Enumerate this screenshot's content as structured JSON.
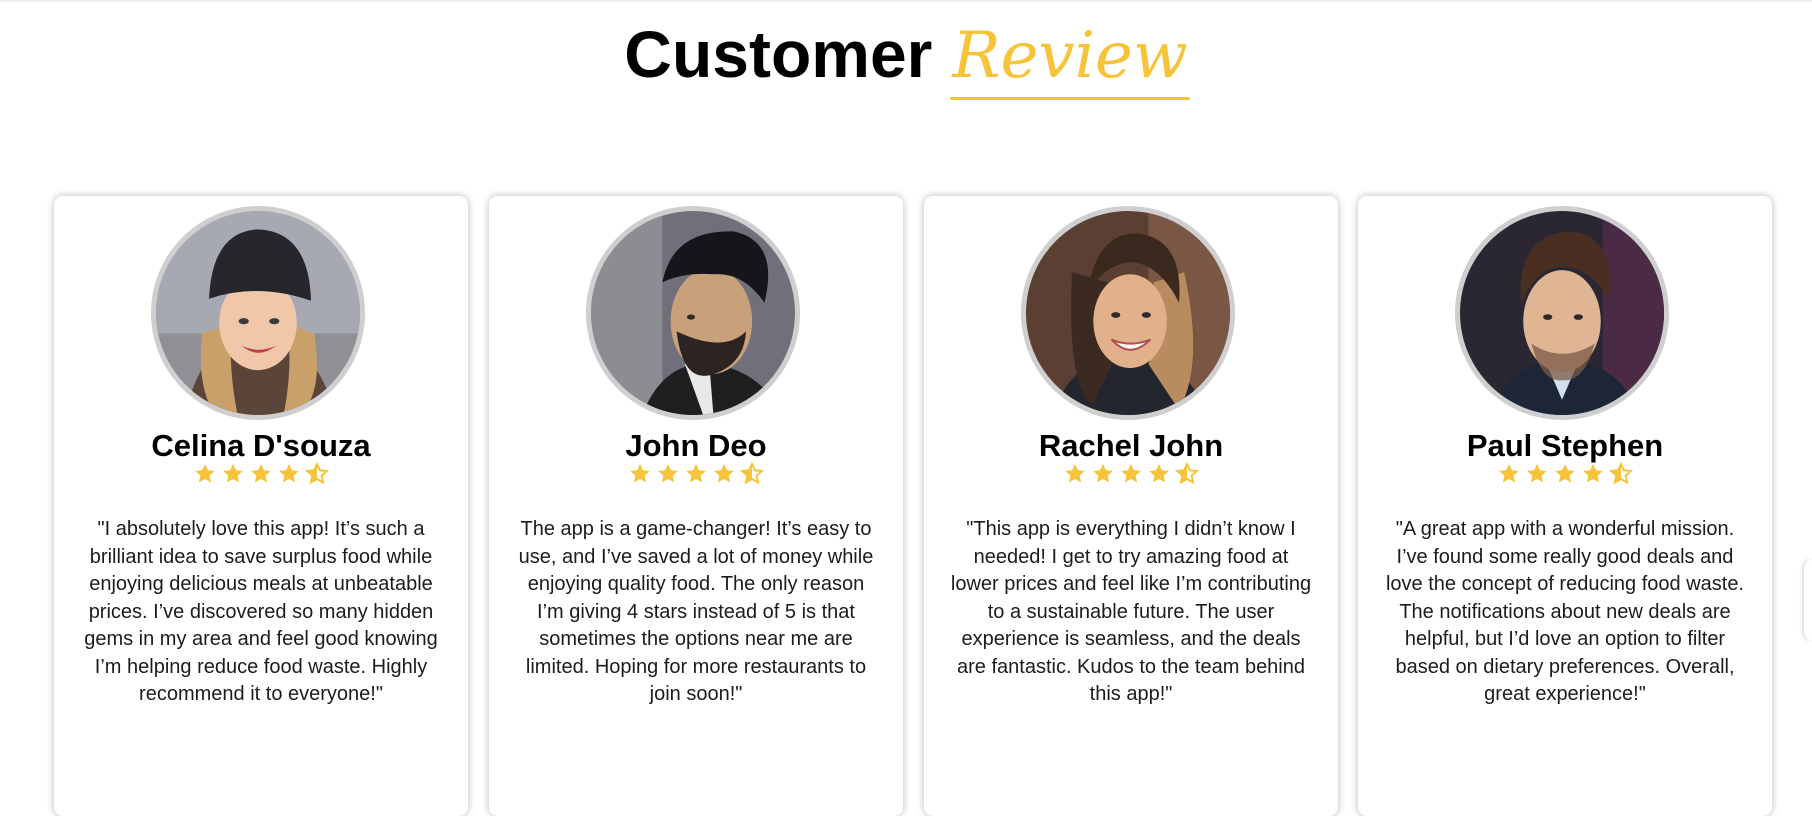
{
  "section": {
    "title_main": "Customer",
    "title_accent": "Review",
    "accent_color": "#f7c338"
  },
  "reviews": [
    {
      "name": "Celina D'souza",
      "rating": 4.5,
      "text": "\"I absolutely love this app! It’s such a brilliant idea to save surplus food while enjoying delicious meals at unbeatable prices. I’ve discovered so many hidden gems in my area and feel good knowing I’m helping reduce food waste. Highly recommend it to everyone!\""
    },
    {
      "name": "John Deo",
      "rating": 4.5,
      "text": "The app is a game-changer! It’s easy to use, and I’ve saved a lot of money while enjoying quality food. The only reason I’m giving 4 stars instead of 5 is that sometimes the options near me are limited. Hoping for more restaurants to join soon!\""
    },
    {
      "name": "Rachel John",
      "rating": 4.5,
      "text": "\"This app is everything I didn’t know I needed! I get to try amazing food at lower prices and feel like I’m contributing to a sustainable future. The user experience is seamless, and the deals are fantastic. Kudos to the team behind this app!\""
    },
    {
      "name": "Paul Stephen",
      "rating": 4.5,
      "text": "\"A great app with a wonderful mission. I’ve found some really good deals and love the concept of reducing food waste. The notifications about new deals are helpful, but I’d love an option to filter based on dietary preferences. Overall, great experience!\""
    }
  ],
  "icons": {
    "star_full": "star-icon",
    "star_half": "star-half-icon"
  }
}
